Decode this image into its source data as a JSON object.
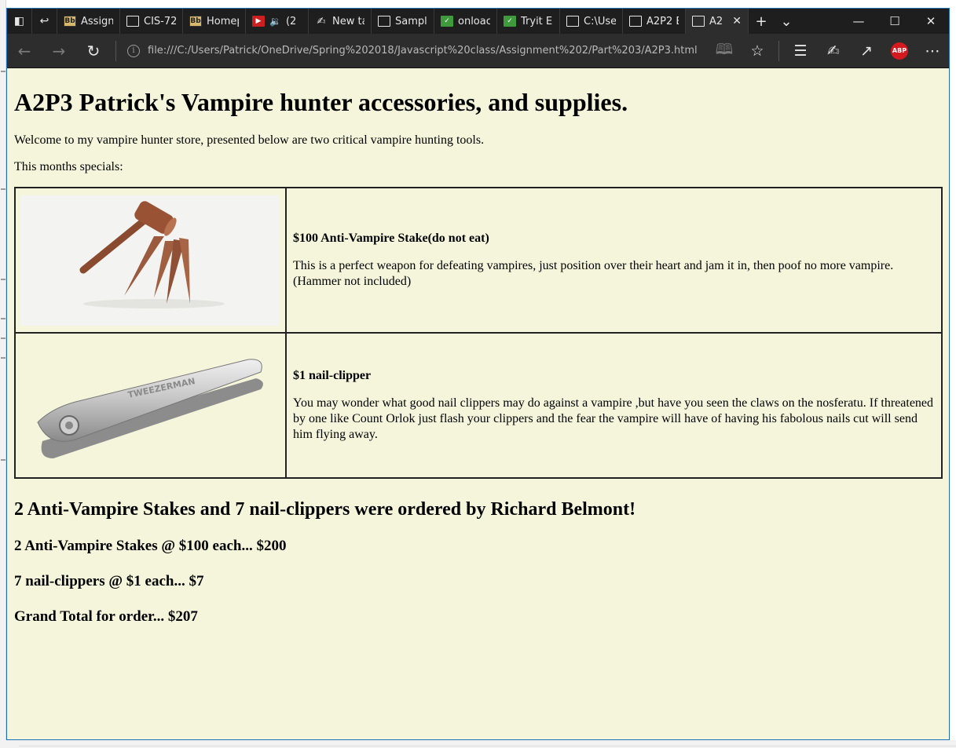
{
  "tabs": [
    {
      "label": "Assign",
      "favicon": "bb-icon",
      "active": false
    },
    {
      "label": "CIS-72",
      "favicon": "page-icon",
      "active": false
    },
    {
      "label": "Homep",
      "favicon": "bb-icon",
      "active": false
    },
    {
      "label": "(2",
      "favicon": "youtube-icon",
      "active": false
    },
    {
      "label": "New ta",
      "favicon": "pen-icon",
      "active": false
    },
    {
      "label": "Sampl",
      "favicon": "page-icon",
      "active": false
    },
    {
      "label": "onloac",
      "favicon": "green-icon",
      "active": false
    },
    {
      "label": "Tryit E",
      "favicon": "green-icon",
      "active": false
    },
    {
      "label": "C:\\Use",
      "favicon": "page-icon",
      "active": false
    },
    {
      "label": "A2P2 E",
      "favicon": "page-icon",
      "active": false
    },
    {
      "label": "A2",
      "favicon": "page-icon",
      "active": true
    }
  ],
  "favicon_text": {
    "bb": "Bb"
  },
  "address_bar": {
    "url": "file:///C:/Users/Patrick/OneDrive/Spring%202018/Javascript%20class/Assignment%202/Part%203/A2P3.html"
  },
  "page": {
    "title": "A2P3 Patrick's Vampire hunter accessories, and supplies.",
    "welcome": "Welcome to my vampire hunter store, presented below are two critical vampire hunting tools.",
    "specials_label": "This months specials:",
    "products": [
      {
        "name": "$100 Anti-Vampire Stake(do not eat)",
        "description": "This is a perfect weapon for defeating vampires, just position over their heart and jam it in, then poof no more vampire.",
        "note": "(Hammer not included)"
      },
      {
        "name": "$1 nail-clipper",
        "description": "You may wonder what good nail clippers may do against a vampire ,but have you seen the claws on the nosferatu. If threatened by one like Count Orlok just flash your clippers and the fear the vampire will have of having his fabolous nails cut will send him flying away.",
        "brand_text": "TWEEZERMAN"
      }
    ],
    "order": {
      "summary": "2 Anti-Vampire Stakes and 7 nail-clippers were ordered by Richard Belmont!",
      "line1": "2 Anti-Vampire Stakes @ $100 each... $200",
      "line2": "7 nail-clippers @ $1 each... $7",
      "total": "Grand Total for order... $207"
    }
  },
  "colors": {
    "page_background": "#f5f5dc",
    "chrome_dark": "#1e1e1e",
    "window_border": "#1f6fb8",
    "adblock_red": "#d4191f"
  },
  "icons": {
    "adblock_label": "ABP"
  }
}
